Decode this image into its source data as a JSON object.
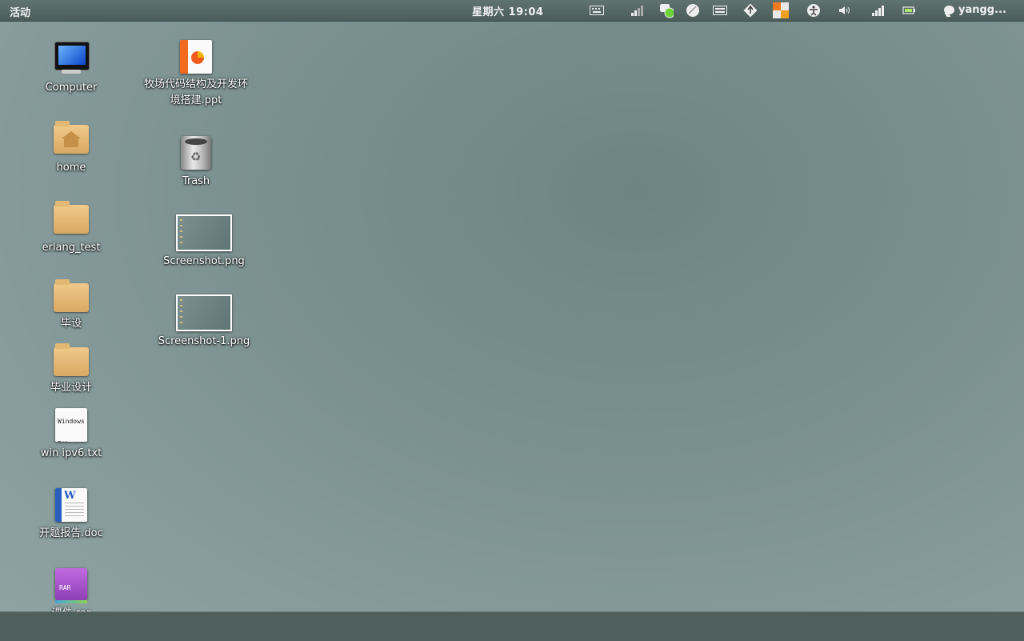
{
  "topbar": {
    "activities": "活动",
    "clock": "星期六 19:04",
    "user": "yangg..."
  },
  "tray_icons": [
    "keyboard-icon",
    "signal-icon",
    "chat-status-icon",
    "network-ball-icon",
    "keyboard-layout-icon",
    "updates-icon",
    "app-indicator-icon",
    "accessibility-icon",
    "volume-icon",
    "wireless-signal-icon",
    "battery-icon"
  ],
  "desktop": {
    "col1": [
      {
        "label": "Computer",
        "type": "computer"
      },
      {
        "label": "home",
        "type": "home"
      },
      {
        "label": "erlang_test",
        "type": "folder"
      },
      {
        "label": "毕设",
        "type": "folder"
      },
      {
        "label": "毕业设计",
        "type": "folder"
      },
      {
        "label": "win ipv6.txt",
        "type": "text",
        "preview": "Windows\nEtherne"
      },
      {
        "label": "开题报告.doc",
        "type": "doc"
      },
      {
        "label": "课件.rar",
        "type": "rar"
      }
    ],
    "col2": [
      {
        "label": "牧场代码结构及开发环境搭建.ppt",
        "type": "ppt"
      },
      {
        "label": "Trash",
        "type": "trash"
      },
      {
        "label": "Screenshot.png",
        "type": "image"
      },
      {
        "label": "Screenshot-1.png",
        "type": "image"
      }
    ]
  },
  "colors": {
    "topbar": "#4b5d5a",
    "bottombar": "#4f5f5c",
    "desktop": "#7a908f"
  }
}
